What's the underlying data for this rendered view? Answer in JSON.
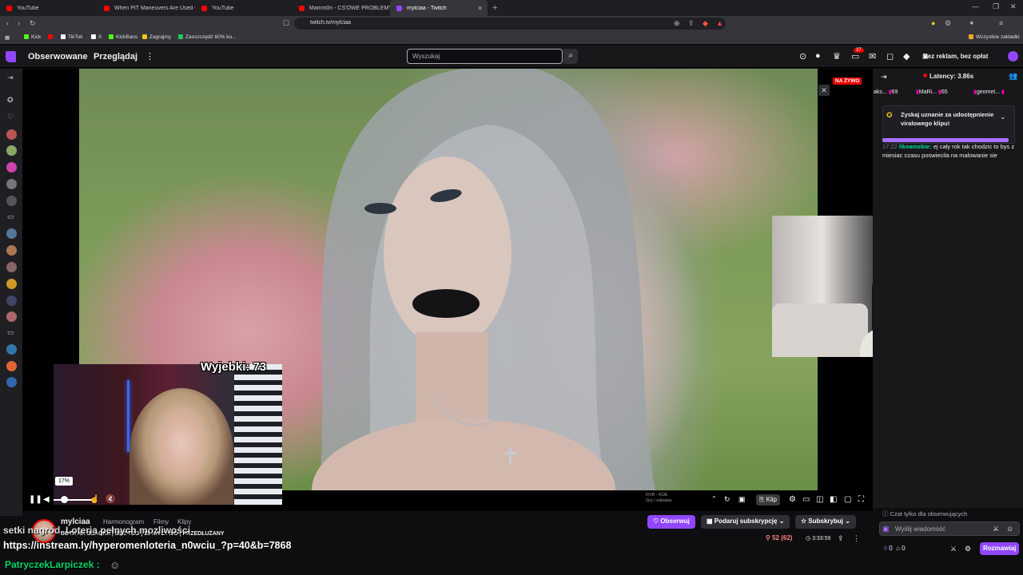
{
  "browser": {
    "tabs": [
      {
        "label": "YouTube",
        "fav": "#ff0000"
      },
      {
        "label": "When PIT Maneuvers Are Used On N",
        "fav": "#ff0000"
      },
      {
        "label": "YouTube",
        "fav": "#ff0000"
      },
      {
        "label": "Mamm0n - CS'OWE PROBLEMY | G",
        "fav": "#ff0000"
      },
      {
        "label": "mylciaa - Twitch",
        "fav": "#9147ff",
        "active": true
      }
    ],
    "url": "twitch.tv/mylciaa",
    "bookmarks": [
      {
        "label": "Kick",
        "color": "#53fc18"
      },
      {
        "label": "TikTok",
        "color": "#ffffff"
      },
      {
        "label": "X",
        "color": "#ffffff"
      },
      {
        "label": "KickBans",
        "color": "#53fc18"
      },
      {
        "label": "Zagrajmy",
        "color": "#f5c518"
      },
      {
        "label": "Zaoszczędź 60% ku...",
        "color": "#22c55e"
      }
    ],
    "all_bookmarks": "Wszystkie zakładki"
  },
  "nav": {
    "following": "Obserwowane",
    "browse": "Przeglądaj",
    "search_placeholder": "Wyszukaj",
    "notifications_count": "37",
    "ad_free": "Bez reklam, bez opłat",
    "twitch_brand": "#9147ff"
  },
  "player": {
    "live_badge": "NA ŻYWO",
    "overlay_counter": "Wyjebki: 73",
    "volume_tooltip": "17%",
    "clip_label": "Klip",
    "rvb_label": "RVB - KOE",
    "rvb_sub": "Gry i zabawa"
  },
  "chat": {
    "latency": "Latency: 3.86s",
    "gifts": [
      {
        "name": "aks...",
        "count": "69"
      },
      {
        "name": "MaRi...",
        "count": "65"
      },
      {
        "name": "geomet...",
        "count": ""
      }
    ],
    "viral_prompt": "Zyskaj uznanie za udostępnienie viralowego klipu!",
    "message": {
      "time": "17:22",
      "user": "likeamebie:",
      "text": "ej cały rok tak chodzic to bys z miesiac czasu poswiecila na malowanie sie"
    },
    "followers_only": "Czat tylko dla obserwujących",
    "input_placeholder": "Wyślij wiadomość",
    "points_a": "0",
    "points_b": "0",
    "send_label": "Rozmawiaj"
  },
  "channel": {
    "name": "mylciaa",
    "tabs": [
      "Harmonogram",
      "Filmy",
      "Klipy"
    ],
    "title": "BOTA NA BLACKA | BEZ TEG | 15 NA ŻYWO | PRZEDŁUŻANY",
    "follow": "Obserwuj",
    "gift_sub": "Podaruj subskrypcję",
    "subscribe": "Subskrybuj",
    "viewers": "52 (62)",
    "uptime": "3:33:59"
  },
  "overlay": {
    "lower_text": "setki nagród. Loteria pełnych mozliwości",
    "link": "https://instream.ly/hyperomenloteria_n0wciu_?p=40&b=7868",
    "user": "PatryczekLarpiczek :"
  }
}
